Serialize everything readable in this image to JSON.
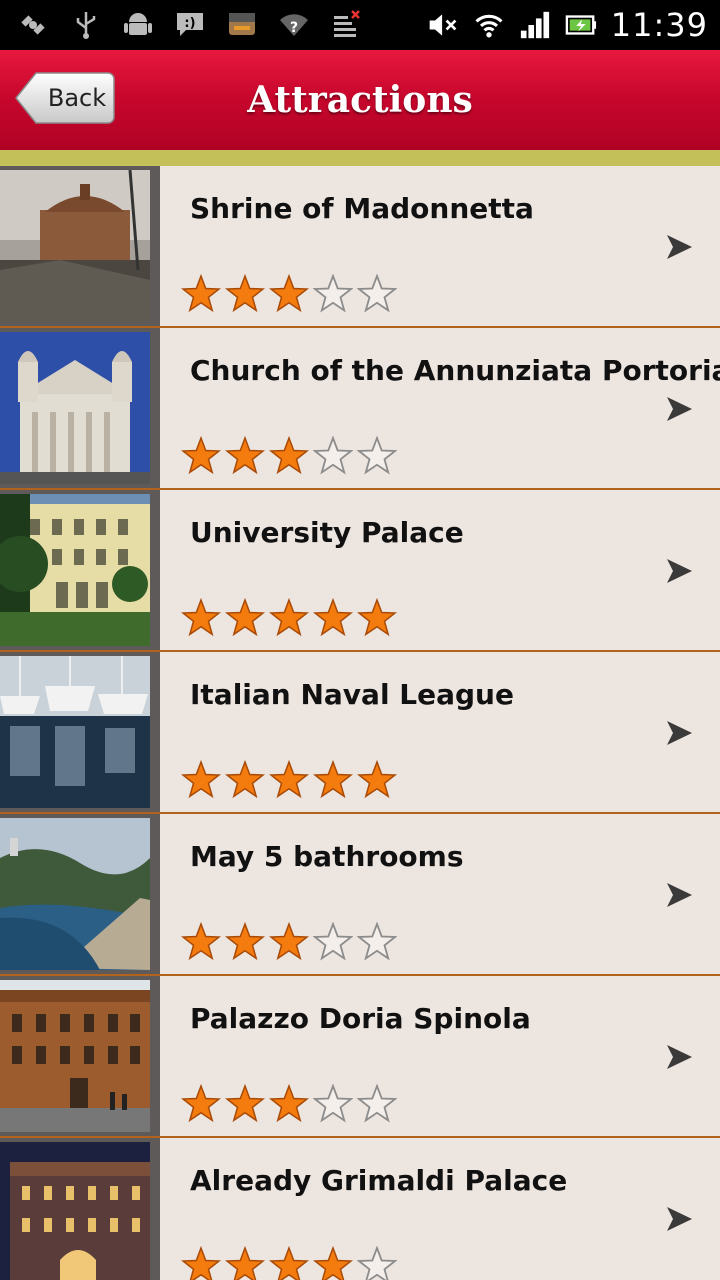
{
  "status_bar": {
    "time": "11:39",
    "left_icons": [
      "satellite-icon",
      "usb-icon",
      "android-icon",
      "message-icon",
      "amazon-icon",
      "wifi-question-icon",
      "data-off-icon"
    ],
    "right_icons": [
      "mute-icon",
      "wifi-icon",
      "signal-icon",
      "battery-icon"
    ]
  },
  "header": {
    "back_label": "Back",
    "title": "Attractions",
    "accent_color": "#c9072d",
    "strip_color": "#c3c05a"
  },
  "attractions": [
    {
      "name": "Shrine of Madonnetta",
      "rating": 3,
      "max_rating": 5
    },
    {
      "name": "Church of the Annunziata Portoria",
      "rating": 3,
      "max_rating": 5
    },
    {
      "name": "University Palace",
      "rating": 5,
      "max_rating": 5
    },
    {
      "name": "Italian Naval League",
      "rating": 5,
      "max_rating": 5
    },
    {
      "name": "May 5 bathrooms",
      "rating": 3,
      "max_rating": 5
    },
    {
      "name": "Palazzo Doria Spinola",
      "rating": 3,
      "max_rating": 5
    },
    {
      "name": "Already Grimaldi Palace",
      "rating": 4,
      "max_rating": 5
    }
  ]
}
